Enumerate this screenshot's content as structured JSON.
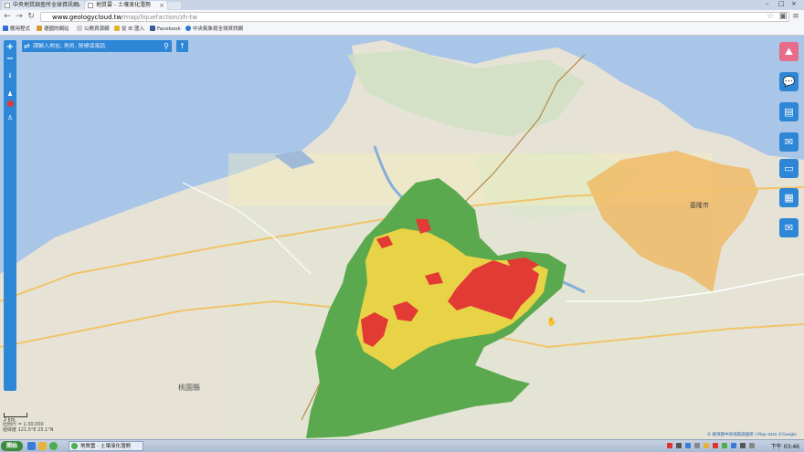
{
  "browser": {
    "tabs": [
      {
        "title": "中央地質調查所全球資訊網"
      },
      {
        "title": "地質雲 - 土壤液化潛勢"
      }
    ],
    "url_host": "www.geologycloud.tw",
    "url_path": "/map/liquefaction/zh-tw",
    "bookmarks": [
      {
        "label": "應用程式",
        "color": "#2f6fd3"
      },
      {
        "label": "德國的網站",
        "color": "#d39b2f"
      },
      {
        "label": "公務資源網",
        "color": "#999999"
      },
      {
        "label": "從 IE 匯入",
        "color": "#e5b22b"
      },
      {
        "label": "Facebook",
        "color": "#3b5998"
      },
      {
        "label": "中央氣象局全球資訊網",
        "color": "#2b7bcf"
      }
    ]
  },
  "map": {
    "search_placeholder": "請輸入地址, 地名, 座標或電話",
    "labels": {
      "taoyuan": "桃園縣",
      "keelung": "基隆市"
    },
    "zoom_in": "+",
    "zoom_out": "−",
    "scale_label": "2 km",
    "coords_line1": "比例尺 = 1:30,000",
    "coords_line2": "經緯度 121.5°E 25.1°N",
    "attribution": "© 經濟部中央地質調查所 | Map data ©Google"
  },
  "legend_colors": {
    "high": "#e23a34",
    "medium": "#e8d245",
    "low": "#5aa94f",
    "county_highlight": "#f0b45a",
    "sea": "#a9c6e8"
  },
  "taskbar": {
    "start_label": "開始",
    "task_label": "地質雲 - 土壤液化潛勢",
    "clock": "下午 03:46"
  }
}
